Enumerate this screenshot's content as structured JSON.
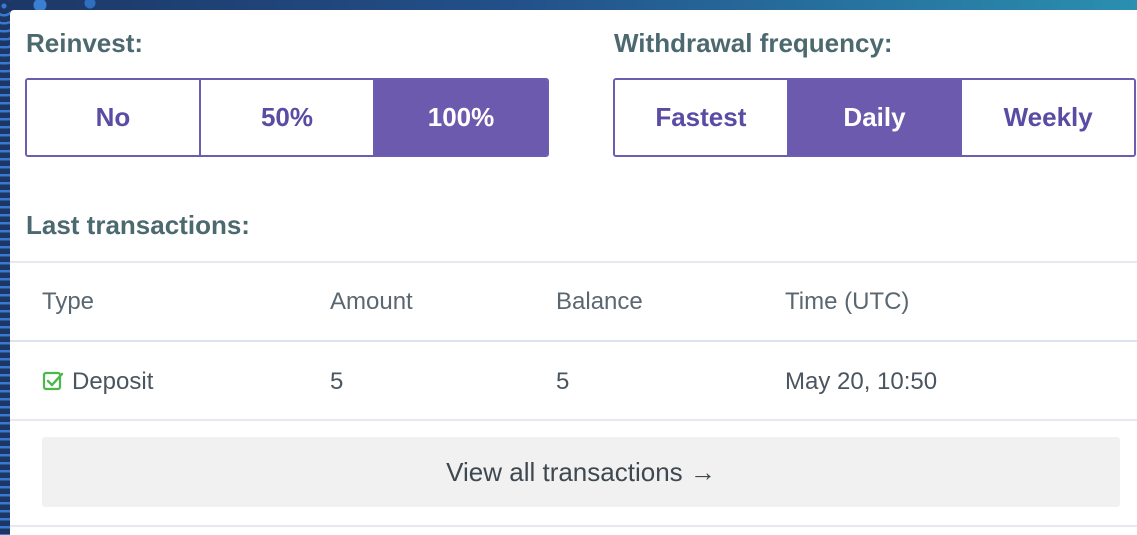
{
  "reinvest": {
    "label": "Reinvest:",
    "options": [
      "No",
      "50%",
      "100%"
    ],
    "selected": "100%"
  },
  "withdrawal": {
    "label": "Withdrawal frequency:",
    "options": [
      "Fastest",
      "Daily",
      "Weekly"
    ],
    "selected": "Daily"
  },
  "transactions": {
    "label": "Last transactions:",
    "columns": [
      "Type",
      "Amount",
      "Balance",
      "Time (UTC)"
    ],
    "rows": [
      {
        "type": "Deposit",
        "amount": "5",
        "balance": "5",
        "time": "May 20, 10:50",
        "icon": "check-square-icon"
      }
    ],
    "view_all": "View all transactions →"
  },
  "colors": {
    "accent": "#6b5aad",
    "deposit_icon": "#4cb84c",
    "label": "#4d6970"
  }
}
